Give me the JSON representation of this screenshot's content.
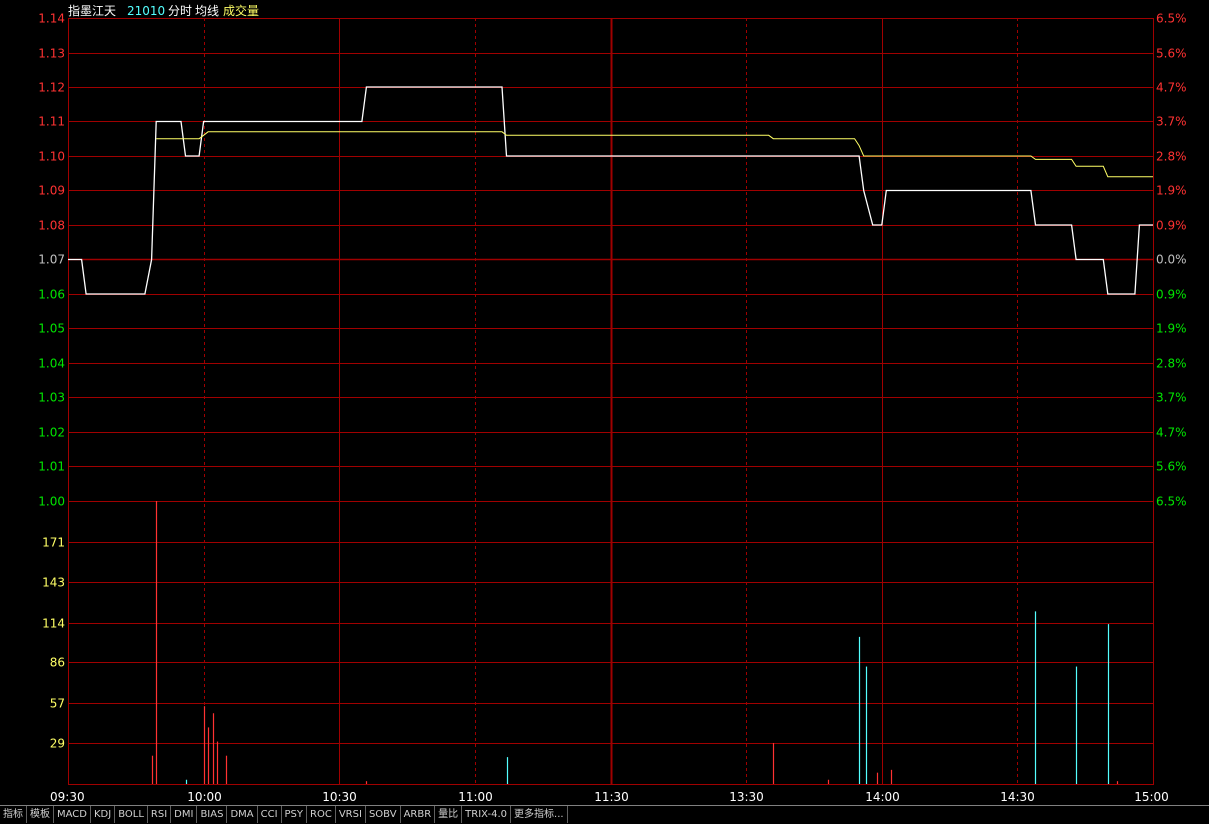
{
  "header": {
    "name": "指墨江天",
    "code": "21010",
    "labels": [
      "分时",
      "均线",
      "成交量"
    ]
  },
  "colors": {
    "grid": "#a00000",
    "up": "#ff3232",
    "down": "#00e600",
    "flat": "#c0c0c0",
    "price_line": "#ffffff",
    "avg_line": "#ffff66",
    "vol_up": "#ff3232",
    "vol_down": "#54ffff",
    "vol_label": "#ffff66"
  },
  "chart_data": [
    {
      "type": "line",
      "name": "price",
      "ylim": [
        1.0,
        1.14
      ],
      "y_ticks": [
        "1.14",
        "1.13",
        "1.12",
        "1.11",
        "1.10",
        "1.09",
        "1.08",
        "1.07",
        "1.06",
        "1.05",
        "1.04",
        "1.03",
        "1.02",
        "1.01",
        "1.00"
      ],
      "y_pct_ticks": [
        "6.5%",
        "5.6%",
        "4.7%",
        "3.7%",
        "2.8%",
        "1.9%",
        "0.9%",
        "0.0%",
        "0.9%",
        "1.9%",
        "2.8%",
        "3.7%",
        "4.7%",
        "5.6%",
        "6.5%"
      ],
      "reference_price": 1.07,
      "x_range_minutes": [
        0,
        240
      ],
      "x_ticks": [
        {
          "label": "09:30",
          "t": 0
        },
        {
          "label": "10:00",
          "t": 30
        },
        {
          "label": "10:30",
          "t": 60
        },
        {
          "label": "11:00",
          "t": 90
        },
        {
          "label": "11:30",
          "t": 120
        },
        {
          "label": "13:30",
          "t": 150
        },
        {
          "label": "14:00",
          "t": 180
        },
        {
          "label": "14:30",
          "t": 210
        },
        {
          "label": "15:00",
          "t": 240
        }
      ],
      "series": [
        {
          "key": "price",
          "points": [
            [
              0,
              1.07
            ],
            [
              3,
              1.07
            ],
            [
              4,
              1.06
            ],
            [
              17,
              1.06
            ],
            [
              18.5,
              1.07
            ],
            [
              19.5,
              1.11
            ],
            [
              25,
              1.11
            ],
            [
              26,
              1.1
            ],
            [
              29,
              1.1
            ],
            [
              30,
              1.11
            ],
            [
              65,
              1.11
            ],
            [
              66,
              1.12
            ],
            [
              96,
              1.12
            ],
            [
              97,
              1.1
            ],
            [
              175,
              1.1
            ],
            [
              176,
              1.09
            ],
            [
              178,
              1.08
            ],
            [
              180,
              1.08
            ],
            [
              181,
              1.09
            ],
            [
              213,
              1.09
            ],
            [
              214,
              1.08
            ],
            [
              222,
              1.08
            ],
            [
              223,
              1.07
            ],
            [
              229,
              1.07
            ],
            [
              230,
              1.06
            ],
            [
              236,
              1.06
            ],
            [
              237,
              1.08
            ],
            [
              240,
              1.08
            ]
          ]
        },
        {
          "key": "avg",
          "points": [
            [
              19.5,
              1.105
            ],
            [
              25,
              1.105
            ],
            [
              29,
              1.105
            ],
            [
              30,
              1.106
            ],
            [
              31,
              1.107
            ],
            [
              90,
              1.107
            ],
            [
              96,
              1.107
            ],
            [
              97,
              1.106
            ],
            [
              155,
              1.106
            ],
            [
              156,
              1.105
            ],
            [
              174,
              1.105
            ],
            [
              175,
              1.103
            ],
            [
              176,
              1.1
            ],
            [
              178,
              1.1
            ],
            [
              179,
              1.1
            ],
            [
              181,
              1.1
            ],
            [
              213,
              1.1
            ],
            [
              214,
              1.099
            ],
            [
              222,
              1.099
            ],
            [
              223,
              1.097
            ],
            [
              229,
              1.097
            ],
            [
              230,
              1.094
            ],
            [
              240,
              1.094
            ],
            [
              240,
              1.094
            ]
          ]
        }
      ]
    },
    {
      "type": "bar",
      "name": "volume",
      "ylim": [
        0,
        200
      ],
      "y_ticks": [
        "171",
        "143",
        "114",
        "86",
        "57",
        "29"
      ],
      "y_tick_values": [
        171,
        143,
        114,
        86,
        57,
        29
      ],
      "bars": [
        {
          "t": 18.5,
          "v": 20,
          "dir": "up"
        },
        {
          "t": 19.5,
          "v": 200,
          "dir": "up"
        },
        {
          "t": 26,
          "v": 3,
          "dir": "down"
        },
        {
          "t": 30,
          "v": 55,
          "dir": "up"
        },
        {
          "t": 31,
          "v": 40,
          "dir": "up"
        },
        {
          "t": 32,
          "v": 50,
          "dir": "up"
        },
        {
          "t": 33,
          "v": 30,
          "dir": "up"
        },
        {
          "t": 35,
          "v": 20,
          "dir": "up"
        },
        {
          "t": 66,
          "v": 2,
          "dir": "up"
        },
        {
          "t": 97,
          "v": 19,
          "dir": "down"
        },
        {
          "t": 156,
          "v": 29,
          "dir": "up"
        },
        {
          "t": 168,
          "v": 3,
          "dir": "up"
        },
        {
          "t": 175,
          "v": 104,
          "dir": "down"
        },
        {
          "t": 176.5,
          "v": 83,
          "dir": "down"
        },
        {
          "t": 179,
          "v": 8,
          "dir": "up"
        },
        {
          "t": 182,
          "v": 10,
          "dir": "up"
        },
        {
          "t": 214,
          "v": 122,
          "dir": "down"
        },
        {
          "t": 223,
          "v": 83,
          "dir": "down"
        },
        {
          "t": 230,
          "v": 113,
          "dir": "down"
        },
        {
          "t": 232,
          "v": 2,
          "dir": "up"
        }
      ]
    }
  ],
  "tabs": [
    "指标",
    "模板",
    "MACD",
    "KDJ",
    "BOLL",
    "RSI",
    "DMI",
    "BIAS",
    "DMA",
    "CCI",
    "PSY",
    "ROC",
    "VRSI",
    "SOBV",
    "ARBR",
    "量比",
    "TRIX-4.0",
    "更多指标..."
  ]
}
